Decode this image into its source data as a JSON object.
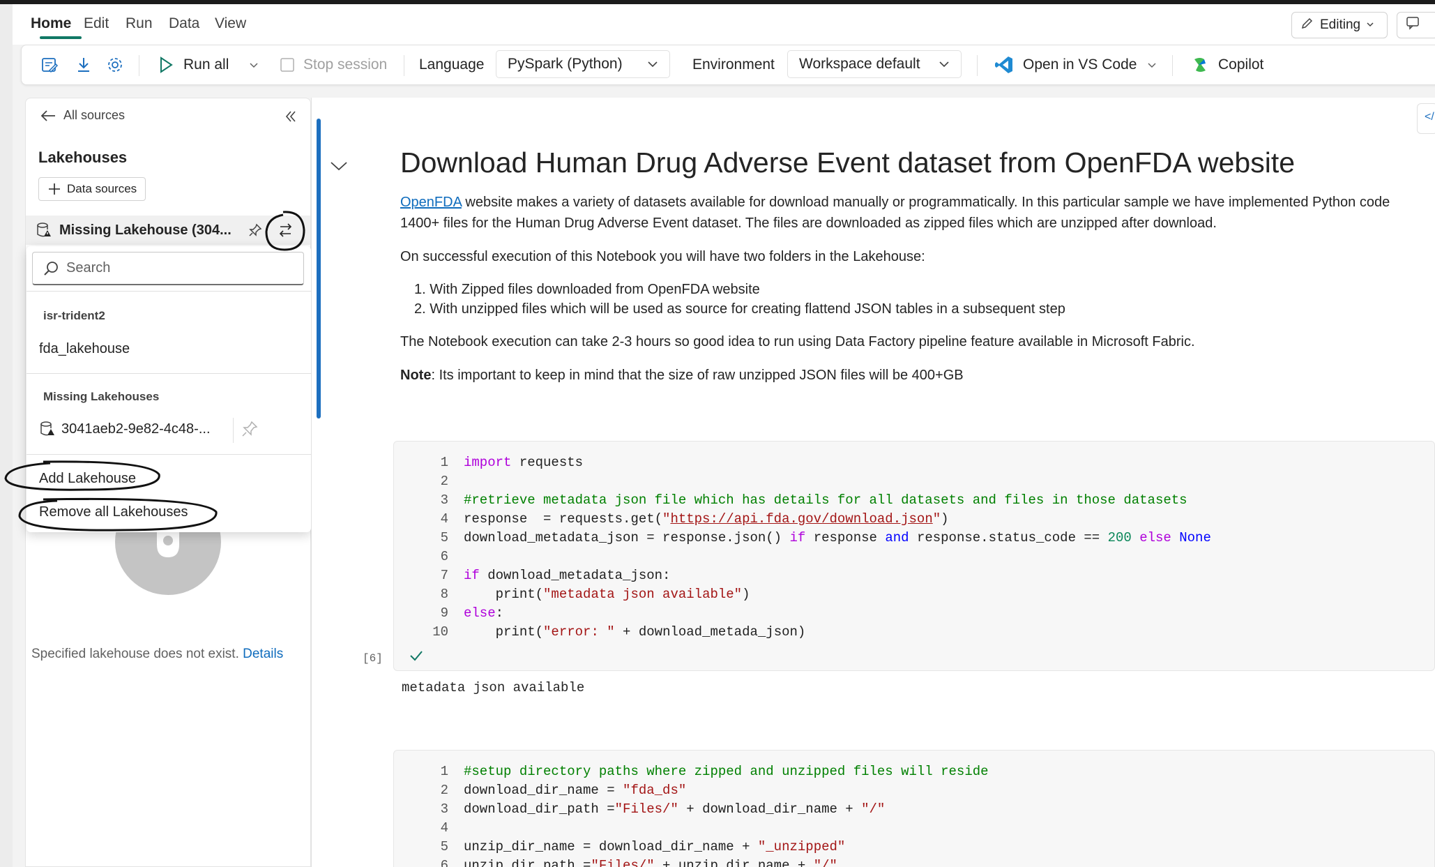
{
  "menu": {
    "tabs": [
      "Home",
      "Edit",
      "Run",
      "Data",
      "View"
    ],
    "editing_label": "Editing"
  },
  "toolbar": {
    "run_all": "Run all",
    "stop_session": "Stop session",
    "language_label": "Language",
    "language_value": "PySpark (Python)",
    "environment_label": "Environment",
    "environment_value": "Workspace default",
    "open_vscode": "Open in VS Code",
    "copilot": "Copilot"
  },
  "explorer": {
    "all_sources": "All sources",
    "section_title": "Lakehouses",
    "data_sources_button": "Data sources",
    "current_lakehouse": "Missing Lakehouse (304...",
    "empty_message": "Specified lakehouse does not exist.",
    "details_link": "Details"
  },
  "popup": {
    "search_placeholder": "Search",
    "workspace_group": "isr-trident2",
    "workspace_item": "fda_lakehouse",
    "missing_group": "Missing Lakehouses",
    "missing_item": "3041aeb2-9e82-4c48-...",
    "add_lakehouse": "Add Lakehouse",
    "remove_all": "Remove all Lakehouses"
  },
  "markdown": {
    "title": "Download Human Drug Adverse Event dataset from OpenFDA website",
    "intro_link": "OpenFDA",
    "intro_line1": " website makes a variety of datasets available for download manually or programmatically. In this particular sample we have implemented Python code",
    "intro_line2": "1400+ files for the Human Drug Adverse Event dataset. The files are downloaded as zipped files which are unzipped after download.",
    "p2": "On successful execution of this Notebook you will have two folders in the Lakehouse:",
    "list": [
      "1. With Zipped files downloaded from OpenFDA website",
      "2. With unzipped files which will be used as source for creating flattend JSON tables in a subsequent step"
    ],
    "p3": "The Notebook execution can take 2-3 hours so good idea to run using Data Factory pipeline feature available in Microsoft Fabric.",
    "note_label": "Note",
    "note_text": ": Its important to keep in mind that the size of raw unzipped JSON files will be 400+GB"
  },
  "cell1": {
    "line_numbers": [
      "1",
      "2",
      "3",
      "4",
      "5",
      "6",
      "7",
      "8",
      "9",
      "10"
    ],
    "exec_count": "[6]",
    "output": "metadata json available"
  },
  "cell2": {
    "line_numbers": [
      "1",
      "2",
      "3",
      "4",
      "5",
      "6"
    ]
  },
  "colors": {
    "accent_green": "#117865",
    "splitter_blue": "#1d6fbf",
    "link_blue": "#0f6cbd"
  }
}
